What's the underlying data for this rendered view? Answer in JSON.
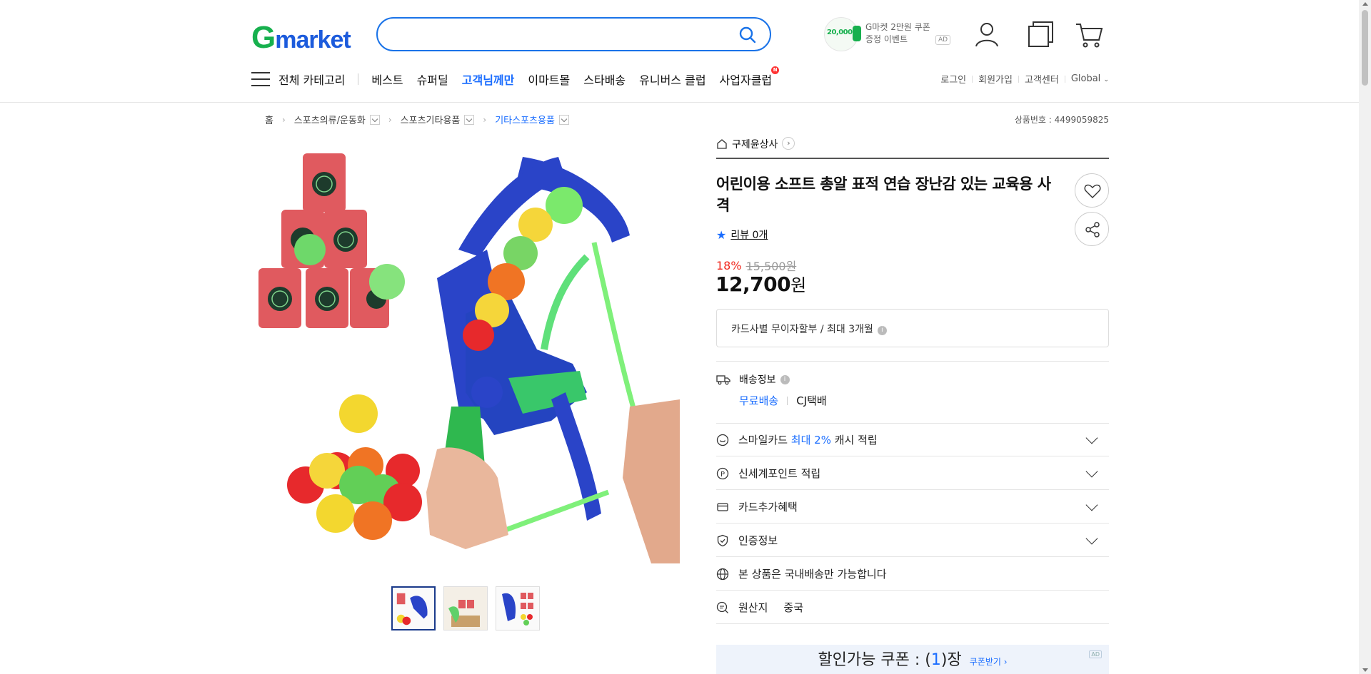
{
  "header": {
    "logo_g": "G",
    "logo_rest": "market",
    "search_placeholder": "",
    "promo": {
      "amount": "20,000",
      "line1": "G마켓 2만원 쿠폰",
      "line2": "증정 이벤트",
      "ad": "AD"
    }
  },
  "nav": {
    "all_categories": "전체 카테고리",
    "items": [
      "베스트",
      "슈퍼딜",
      "고객님께만",
      "이마트몰",
      "스타배송",
      "유니버스 클럽",
      "사업자클럽"
    ],
    "new_badge": "N",
    "util": [
      "로그인",
      "회원가입",
      "고객센터",
      "Global"
    ]
  },
  "breadcrumb": {
    "home": "홈",
    "items": [
      "스포츠의류/운동화",
      "스포츠기타용품",
      "기타스포츠용품"
    ],
    "product_no": "상품번호 : 4499059825"
  },
  "product": {
    "seller": "구제윤상사",
    "title": "어린이용 소프트 총알 표적 연습 장난감 있는 교육용 사격",
    "review": "리뷰 0개",
    "discount_rate": "18%",
    "original_price": "15,500원",
    "price_num": "12,700",
    "price_unit": "원",
    "installment": "카드사별 무이자할부 / 최대 3개월",
    "shipping_label": "배송정보",
    "shipping_free": "무료배송",
    "shipping_carrier": "CJ택배",
    "rows": {
      "smile_pre": "스마일카드",
      "smile_blue": "최대 2%",
      "smile_post": "캐시 적립",
      "shinsegae": "신세계포인트 적립",
      "card": "카드추가혜택",
      "cert": "인증정보",
      "domestic": "본 상품은 국내배송만 가능합니다",
      "origin_label": "원산지",
      "origin_value": "중국"
    },
    "coupon": {
      "pre": "할인가능 쿠폰 : (",
      "count": "1",
      "post": ")장",
      "link": "쿠폰받기 ›",
      "ad": "AD"
    }
  },
  "colors": {
    "brand_green": "#17b04e",
    "brand_blue": "#1c5bdc",
    "accent": "#1a6dff",
    "sale_red": "#f0271d"
  }
}
